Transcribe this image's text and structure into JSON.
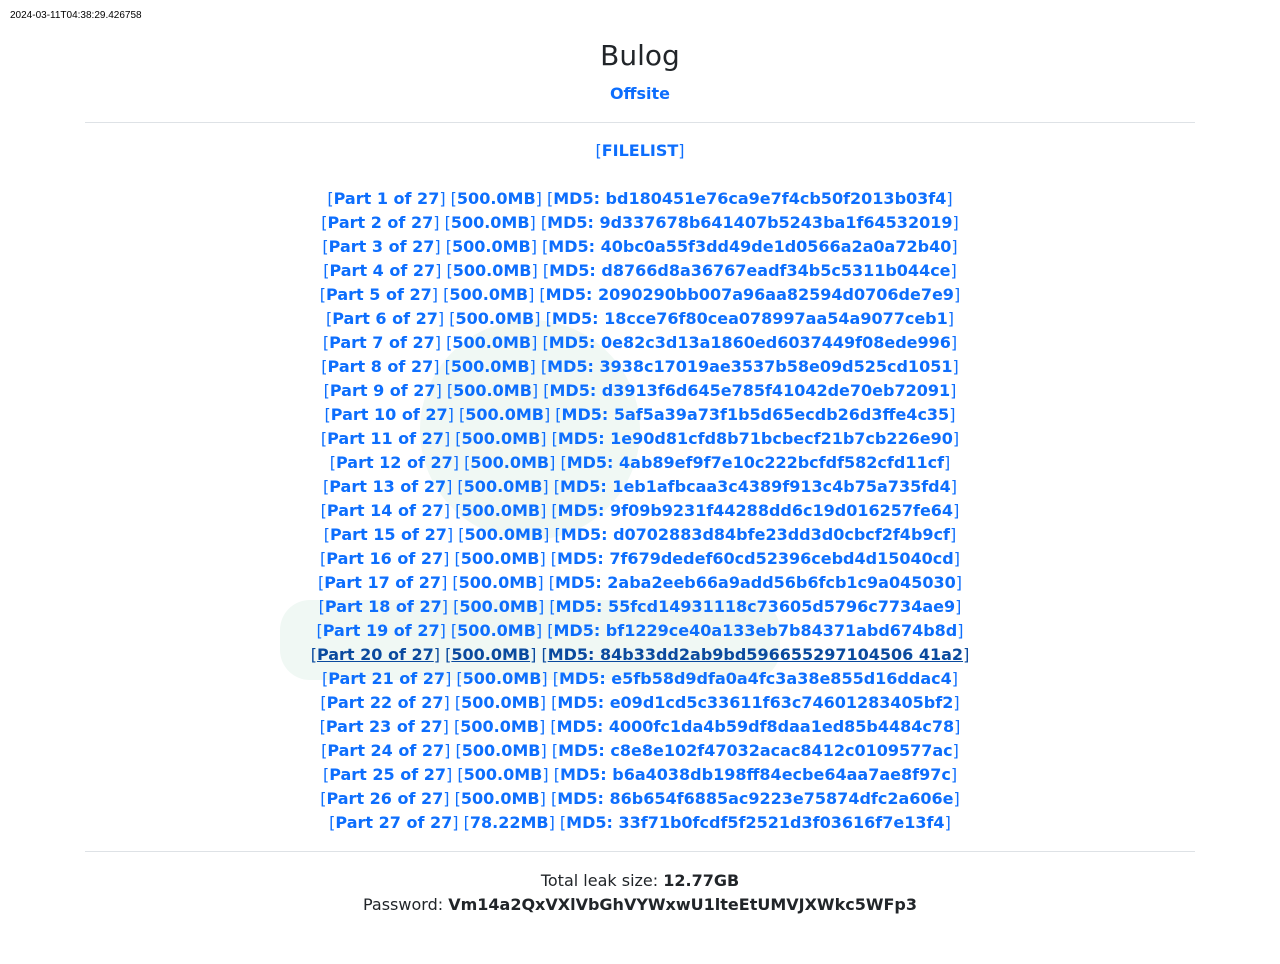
{
  "timestamp": "2024-03-11T04:38:29.426758",
  "header": {
    "title": "Bulog",
    "subtitle_link": "Offsite"
  },
  "filelist_label": "FILELIST",
  "parts": [
    {
      "label": "Part 1 of 27",
      "size": "500.0MB",
      "md5": "MD5: bd180451e76ca9e7f4cb50f2013b03f4"
    },
    {
      "label": "Part 2 of 27",
      "size": "500.0MB",
      "md5": "MD5: 9d337678b641407b5243ba1f64532019"
    },
    {
      "label": "Part 3 of 27",
      "size": "500.0MB",
      "md5": "MD5: 40bc0a55f3dd49de1d0566a2a0a72b40"
    },
    {
      "label": "Part 4 of 27",
      "size": "500.0MB",
      "md5": "MD5: d8766d8a36767eadf34b5c5311b044ce"
    },
    {
      "label": "Part 5 of 27",
      "size": "500.0MB",
      "md5": "MD5: 2090290bb007a96aa82594d0706de7e9"
    },
    {
      "label": "Part 6 of 27",
      "size": "500.0MB",
      "md5": "MD5: 18cce76f80cea078997aa54a9077ceb1"
    },
    {
      "label": "Part 7 of 27",
      "size": "500.0MB",
      "md5": "MD5: 0e82c3d13a1860ed6037449f08ede996"
    },
    {
      "label": "Part 8 of 27",
      "size": "500.0MB",
      "md5": "MD5: 3938c17019ae3537b58e09d525cd1051"
    },
    {
      "label": "Part 9 of 27",
      "size": "500.0MB",
      "md5": "MD5: d3913f6d645e785f41042de70eb72091"
    },
    {
      "label": "Part 10 of 27",
      "size": "500.0MB",
      "md5": "MD5: 5af5a39a73f1b5d65ecdb26d3ffe4c35"
    },
    {
      "label": "Part 11 of 27",
      "size": "500.0MB",
      "md5": "MD5: 1e90d81cfd8b71bcbecf21b7cb226e90"
    },
    {
      "label": "Part 12 of 27",
      "size": "500.0MB",
      "md5": "MD5: 4ab89ef9f7e10c222bcfdf582cfd11cf"
    },
    {
      "label": "Part 13 of 27",
      "size": "500.0MB",
      "md5": "MD5: 1eb1afbcaa3c4389f913c4b75a735fd4"
    },
    {
      "label": "Part 14 of 27",
      "size": "500.0MB",
      "md5": "MD5: 9f09b9231f44288dd6c19d016257fe64"
    },
    {
      "label": "Part 15 of 27",
      "size": "500.0MB",
      "md5": "MD5: d0702883d84bfe23dd3d0cbcf2f4b9cf"
    },
    {
      "label": "Part 16 of 27",
      "size": "500.0MB",
      "md5": "MD5: 7f679dedef60cd52396cebd4d15040cd"
    },
    {
      "label": "Part 17 of 27",
      "size": "500.0MB",
      "md5": "MD5: 2aba2eeb66a9add56b6fcb1c9a045030"
    },
    {
      "label": "Part 18 of 27",
      "size": "500.0MB",
      "md5": "MD5: 55fcd14931118c73605d5796c7734ae9"
    },
    {
      "label": "Part 19 of 27",
      "size": "500.0MB",
      "md5": "MD5: bf1229ce40a133eb7b84371abd674b8d"
    },
    {
      "label": "Part 20 of 27",
      "size": "500.0MB",
      "md5": "MD5: 84b33dd2ab9bd596655297104506 41a2"
    },
    {
      "label": "Part 21 of 27",
      "size": "500.0MB",
      "md5": "MD5: e5fb58d9dfa0a4fc3a38e855d16ddac4"
    },
    {
      "label": "Part 22 of 27",
      "size": "500.0MB",
      "md5": "MD5: e09d1cd5c33611f63c74601283405bf2"
    },
    {
      "label": "Part 23 of 27",
      "size": "500.0MB",
      "md5": "MD5: 4000fc1da4b59df8daa1ed85b4484c78"
    },
    {
      "label": "Part 24 of 27",
      "size": "500.0MB",
      "md5": "MD5: c8e8e102f47032acac8412c0109577ac"
    },
    {
      "label": "Part 25 of 27",
      "size": "500.0MB",
      "md5": "MD5: b6a4038db198ff84ecbe64aa7ae8f97c"
    },
    {
      "label": "Part 26 of 27",
      "size": "500.0MB",
      "md5": "MD5: 86b654f6885ac9223e75874dfc2a606e"
    },
    {
      "label": "Part 27 of 27",
      "size": "78.22MB",
      "md5": "MD5: 33f71b0fcdf5f2521d3f03616f7e13f4"
    }
  ],
  "hovered_part_index": 19,
  "totals": {
    "size_label": "Total leak size:",
    "size_value": "12.77GB",
    "password_label": "Password:",
    "password_value": "Vm14a2QxVXlVbGhVYWxwU1lteEtUMVJXWkc5WFp3"
  },
  "colors": {
    "link": "#0d6efd",
    "text": "#212529",
    "watermark": "#2f9e60"
  }
}
